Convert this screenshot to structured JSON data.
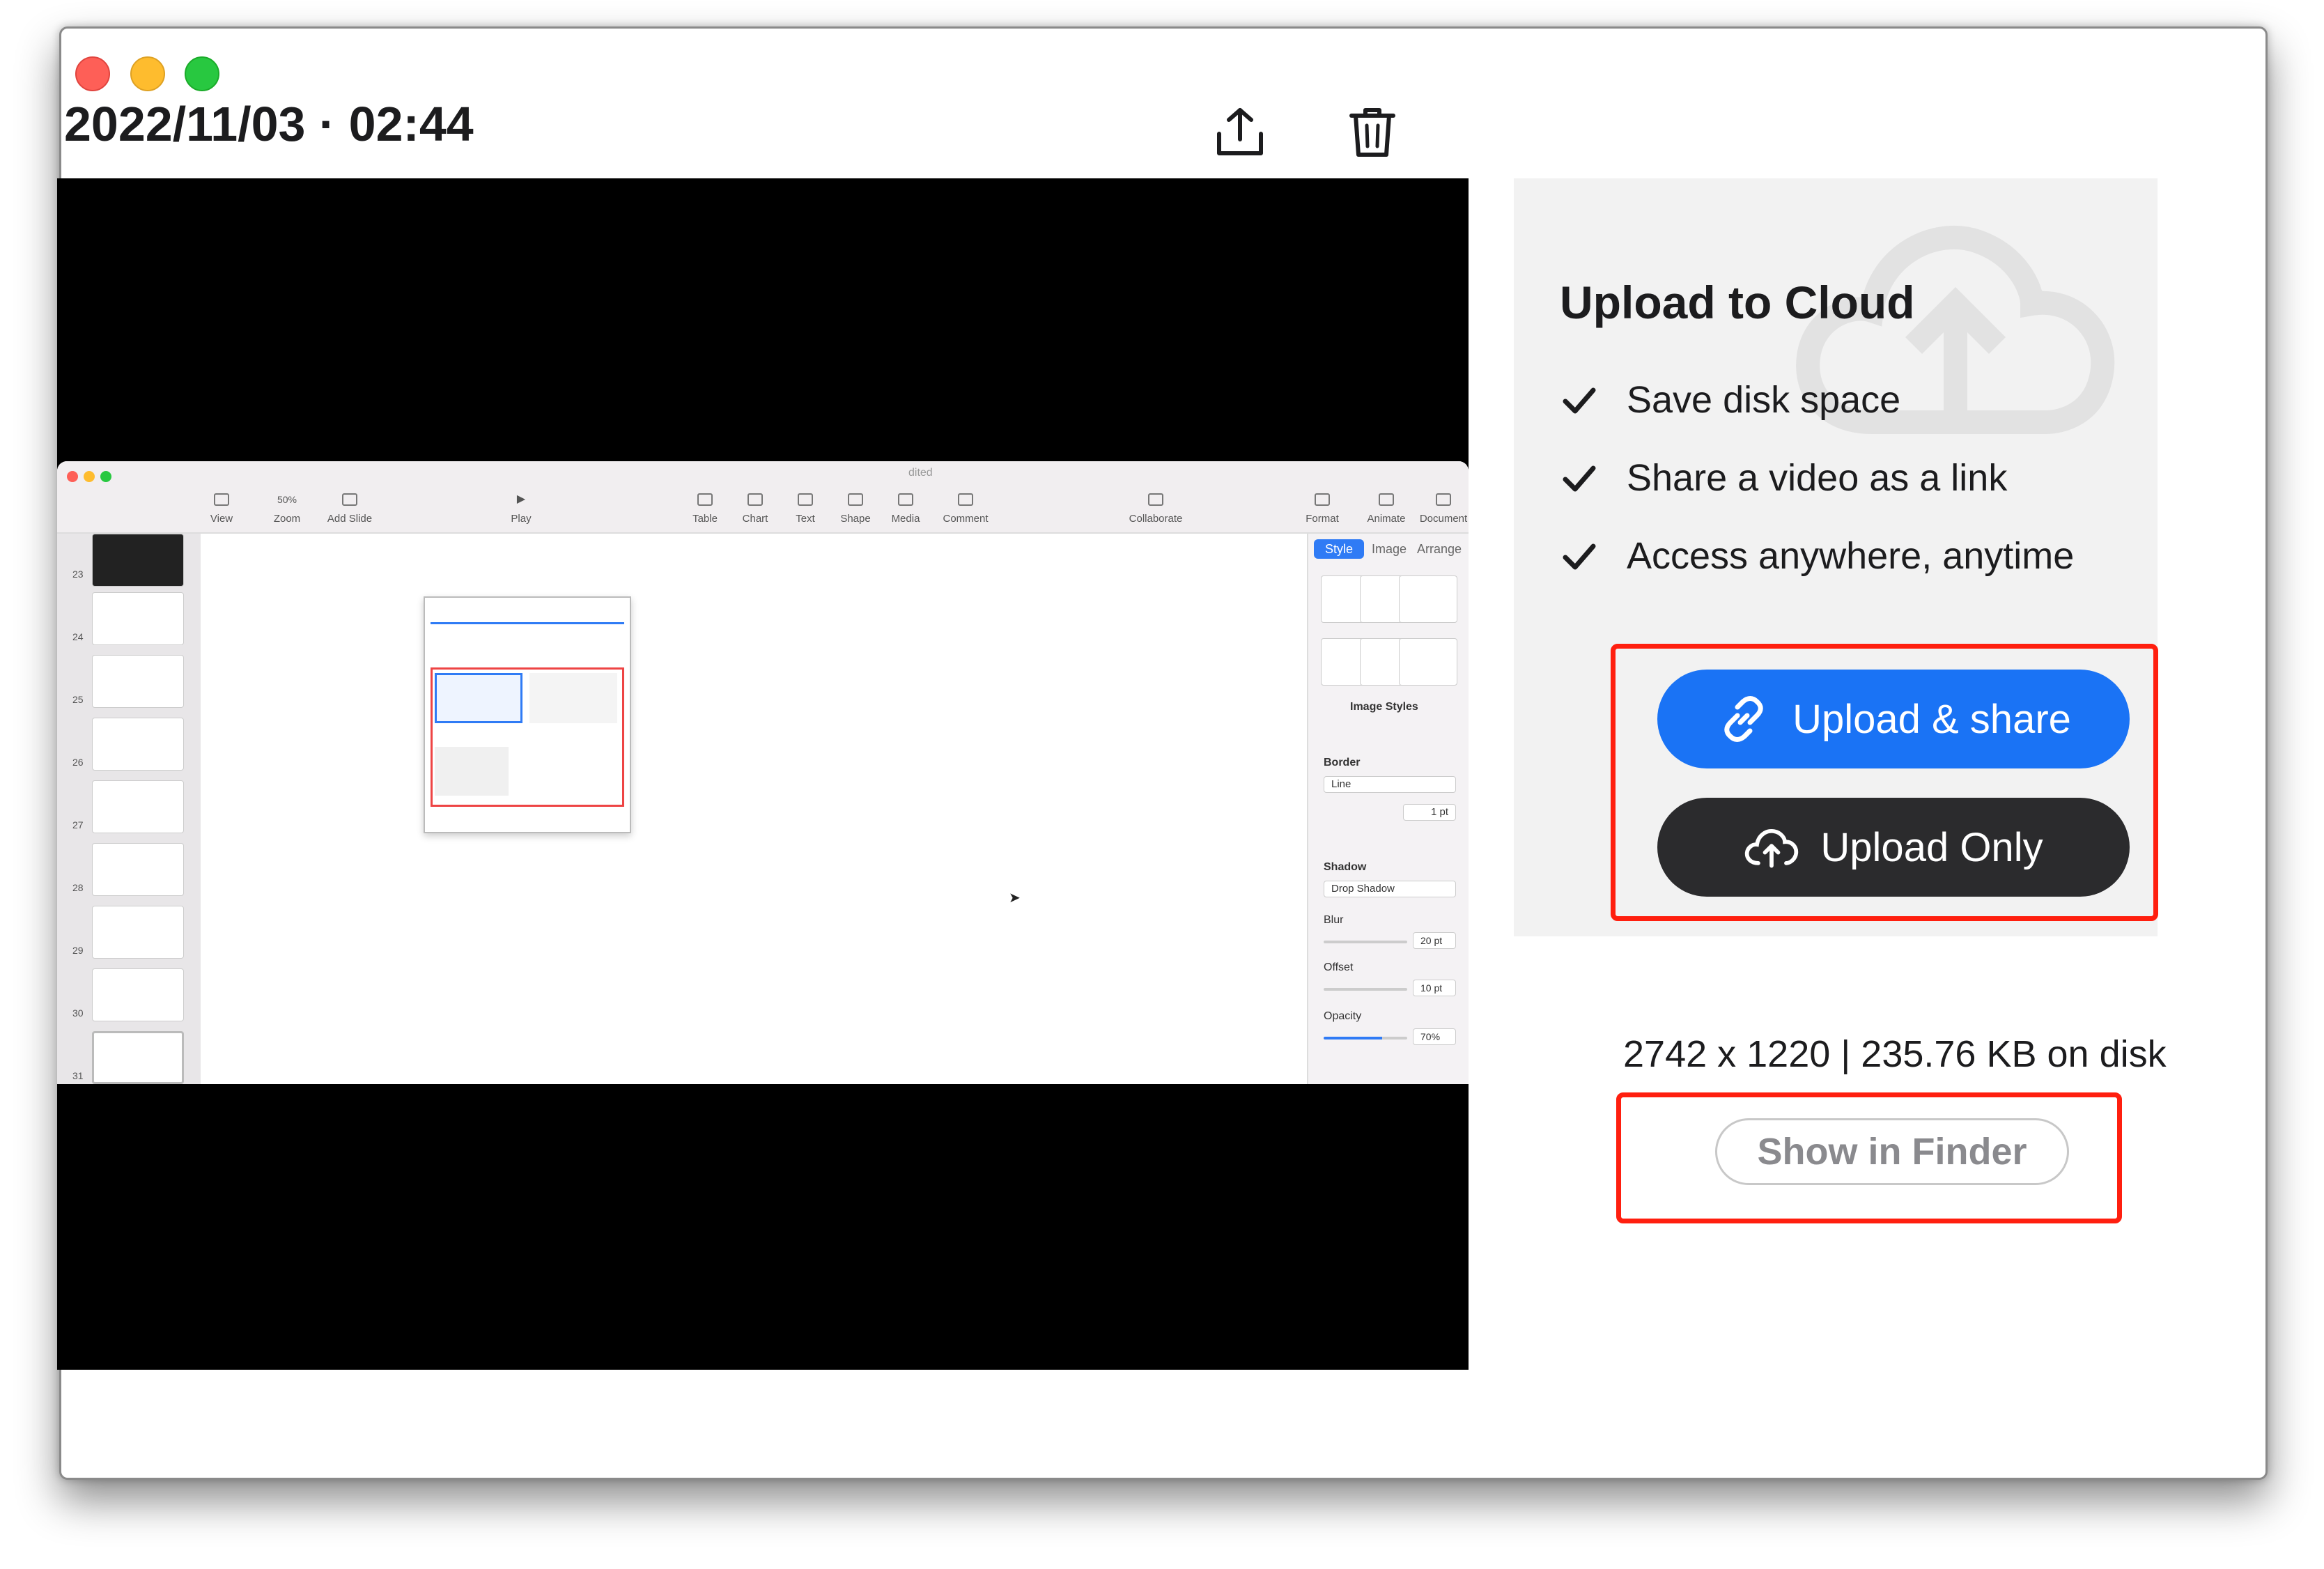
{
  "window": {
    "title": "2022/11/03 · 02:44"
  },
  "header": {
    "share_icon": "share-icon",
    "trash_icon": "trash-icon"
  },
  "preview": {
    "toolbar": [
      {
        "label": "View"
      },
      {
        "label": "Zoom",
        "value": "50%"
      },
      {
        "label": "Add Slide"
      },
      {
        "label": "Play"
      },
      {
        "label": "Table"
      },
      {
        "label": "Chart"
      },
      {
        "label": "Text"
      },
      {
        "label": "Shape"
      },
      {
        "label": "Media"
      },
      {
        "label": "Comment"
      },
      {
        "label": "Collaborate"
      },
      {
        "label": "Format"
      },
      {
        "label": "Animate"
      },
      {
        "label": "Document"
      }
    ],
    "doc_title_fragment": "dited",
    "slide_numbers": [
      "23",
      "24",
      "25",
      "26",
      "27",
      "28",
      "29",
      "30",
      "31"
    ],
    "inspector": {
      "tabs": [
        "Style",
        "Image",
        "Arrange"
      ],
      "image_styles_label": "Image Styles",
      "border_label": "Border",
      "border_type": "Line",
      "border_width": "1 pt",
      "shadow_label": "Shadow",
      "shadow_type": "Drop Shadow",
      "blur_label": "Blur",
      "blur_value": "20 pt",
      "offset_label": "Offset",
      "offset_value": "10 pt",
      "opacity_label": "Opacity",
      "opacity_value": "70%"
    }
  },
  "cloud": {
    "title": "Upload to Cloud",
    "features": [
      "Save disk space",
      "Share a video as a link",
      "Access anywhere, anytime"
    ],
    "upload_share_label": "Upload & share",
    "upload_only_label": "Upload Only",
    "colors": {
      "primary": "#1a73f5",
      "dark": "#2b2b2d",
      "highlight": "#ff1f0f"
    }
  },
  "file": {
    "meta": "2742 x 1220 | 235.76 KB on disk",
    "show_in_finder_label": "Show in Finder"
  }
}
